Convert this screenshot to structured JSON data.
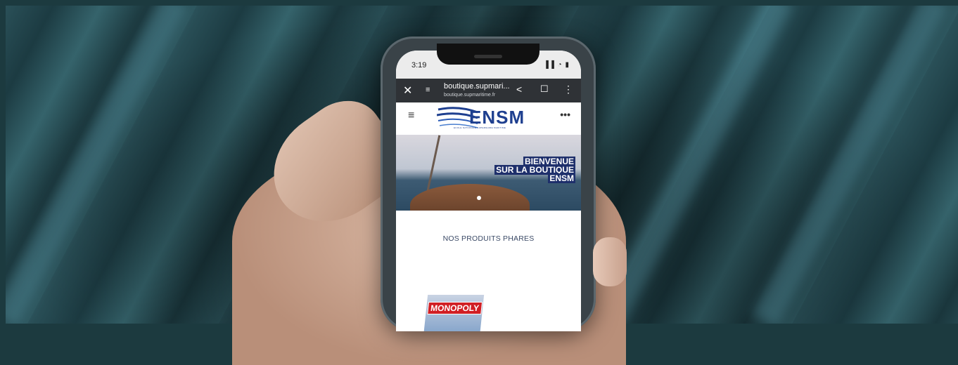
{
  "status": {
    "time": "3:19",
    "icons": "▐▐ ◔ ▮"
  },
  "browser": {
    "close": "✕",
    "site_settings": "≡",
    "title": "boutique.supmari...",
    "url": "boutique.supmaritime.fr",
    "share": "<",
    "bookmark": "☐",
    "more": "⋮"
  },
  "site": {
    "menu": "≡",
    "logo": "ENSM",
    "logo_sub": "ECOLE NATIONALE SUPERIEURE MARITIME",
    "more": "•••"
  },
  "hero": {
    "line1": "BIENVENUE",
    "line2": "SUR LA BOUTIQUE",
    "line3": "ENSM"
  },
  "section": {
    "title": "NOS PRODUITS PHARES"
  },
  "product": {
    "name": "MONOPOLY"
  },
  "colors": {
    "brand": "#1e3f8f",
    "hero_banner": "#1e2f6b",
    "url_bar": "#2f3236"
  }
}
